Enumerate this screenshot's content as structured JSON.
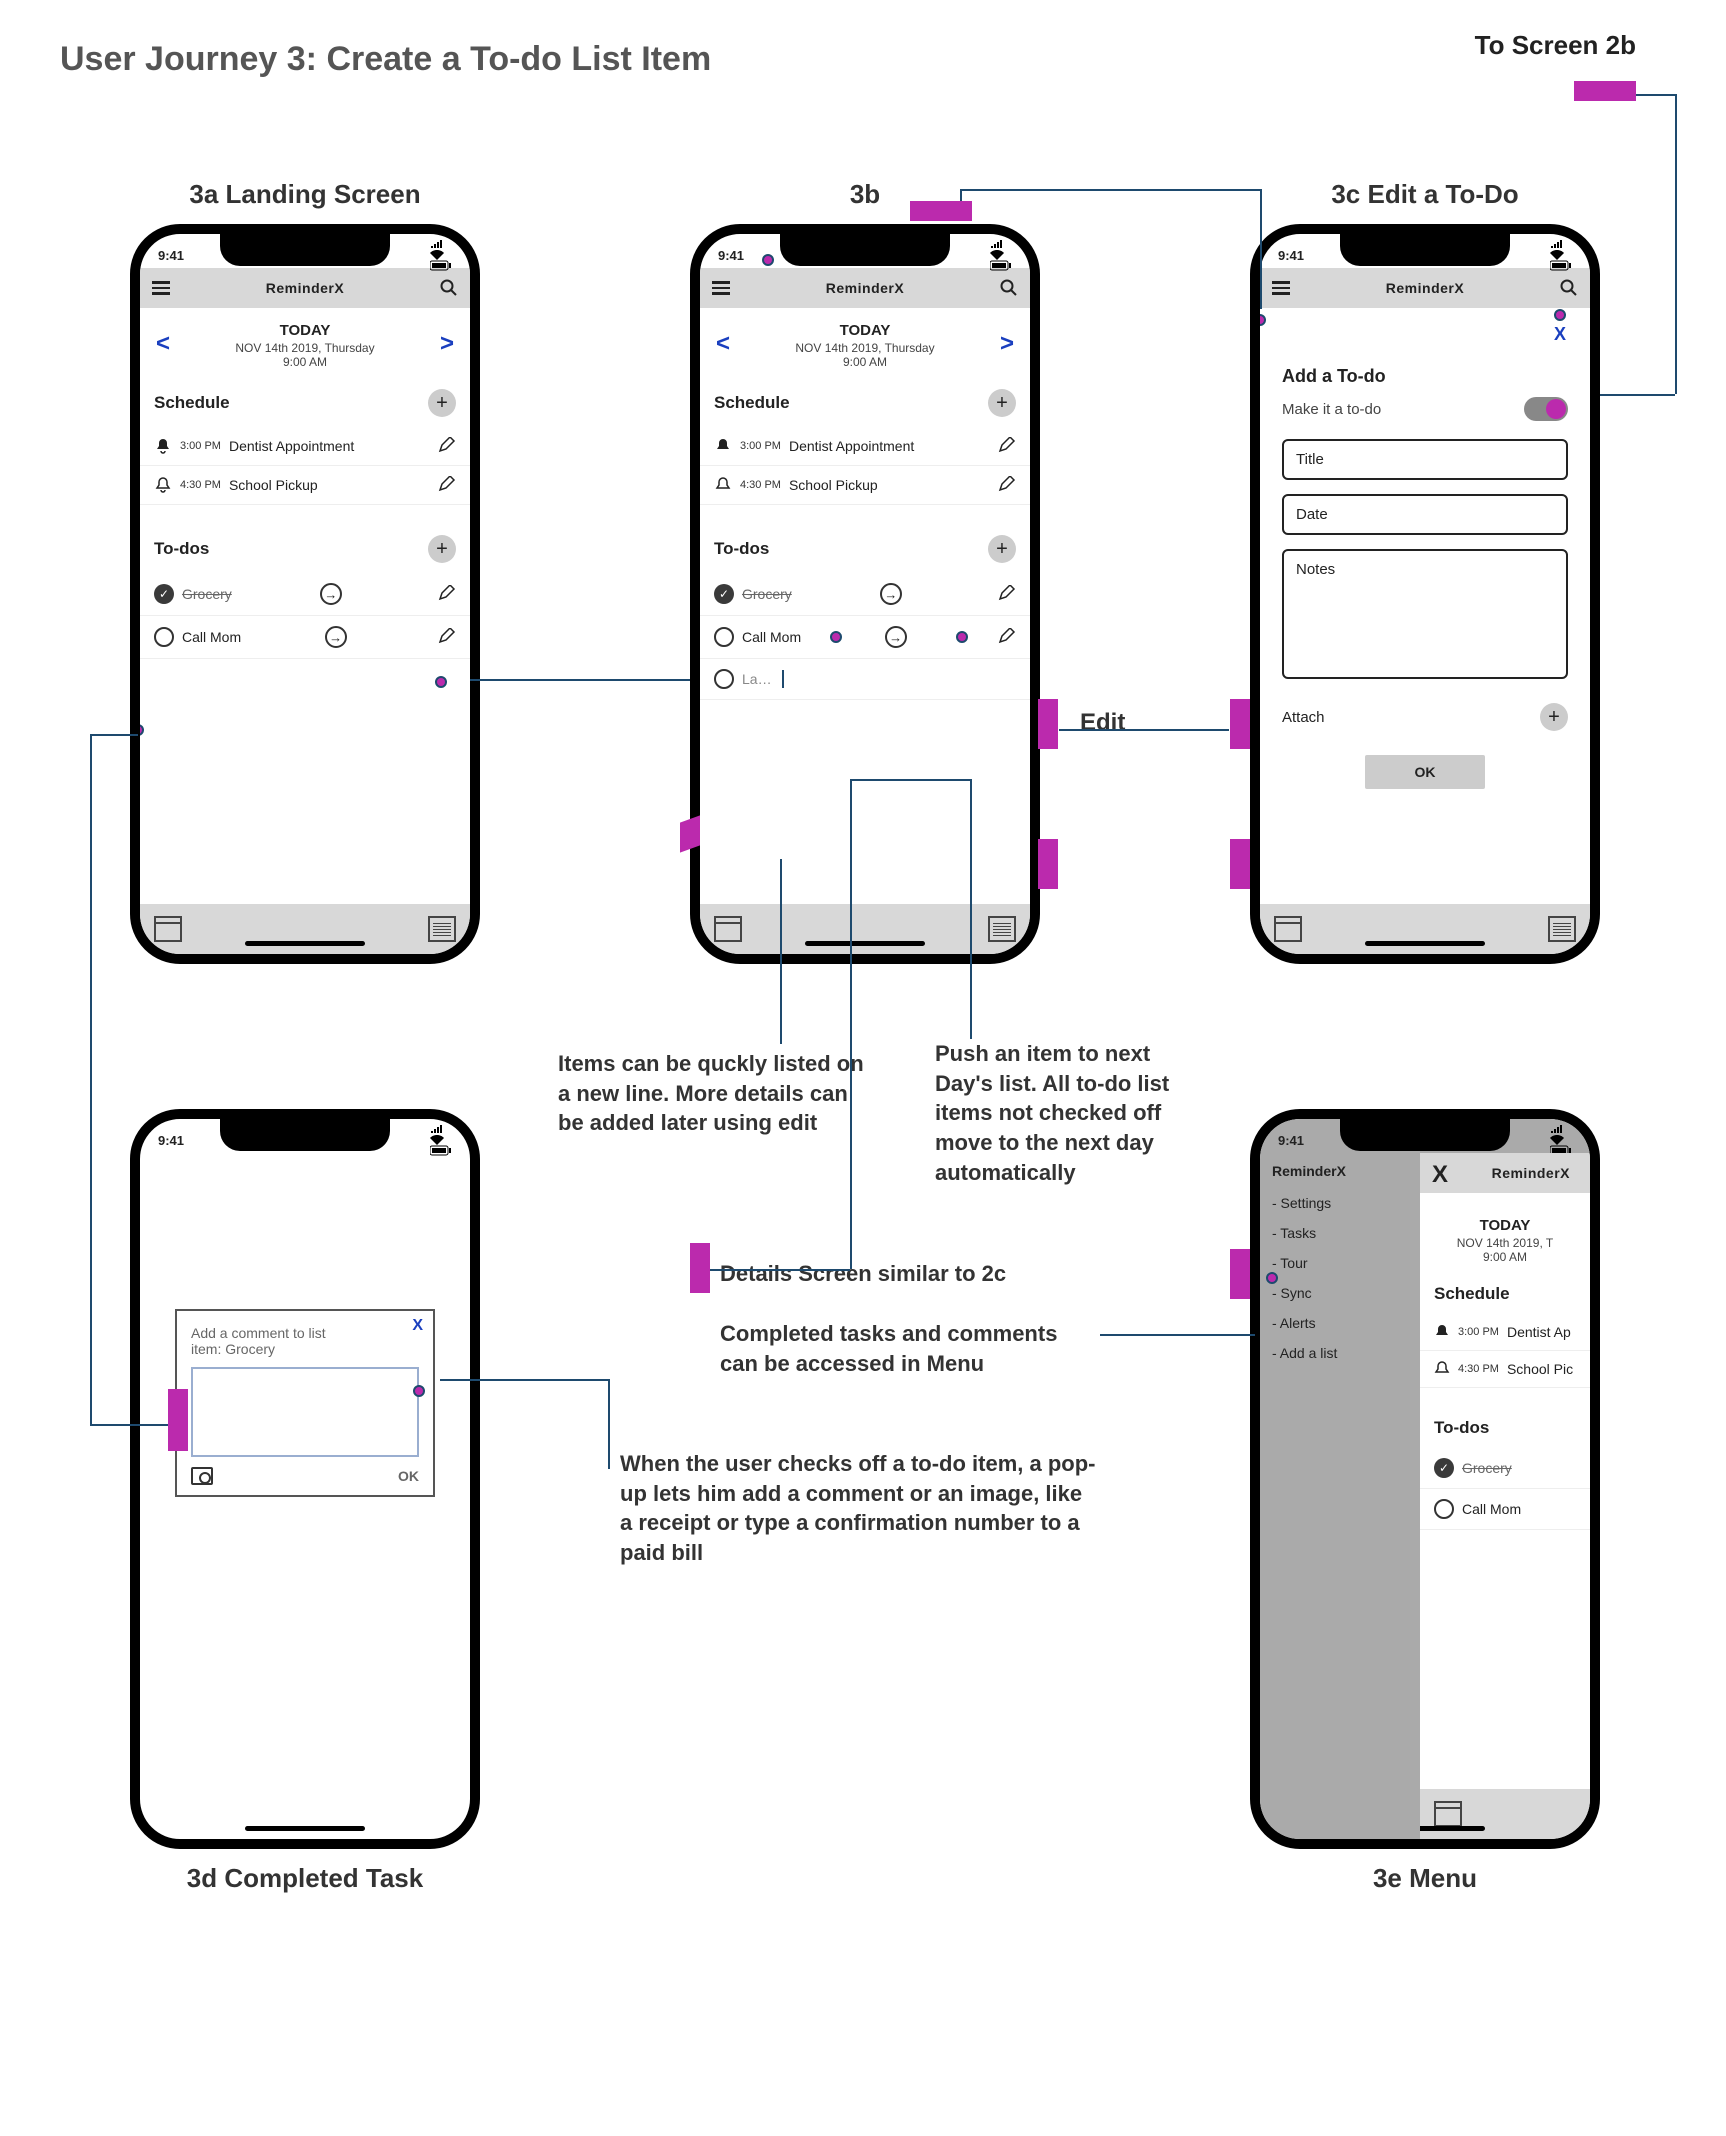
{
  "page_title": "User Journey 3: Create a To-do List Item",
  "to_2b_label": "To Screen 2b",
  "phones": {
    "a": {
      "label_num": "3a",
      "label_text": "Landing Screen",
      "time": "9:41",
      "app_title": "ReminderX",
      "today_label": "TODAY",
      "date": "NOV 14th 2019, Thursday",
      "clock": "9:00 AM",
      "section_schedule": "Schedule",
      "section_todos": "To-dos",
      "schedule": [
        {
          "time": "3:00 PM",
          "text": "Dentist Appointment",
          "alert": true
        },
        {
          "time": "4:30 PM",
          "text": "School Pickup",
          "alert": false
        }
      ],
      "todos": [
        {
          "text": "Grocery",
          "done": true
        },
        {
          "text": "Call Mom",
          "done": false
        }
      ]
    },
    "b": {
      "label_num": "3b",
      "label_text": "",
      "time": "9:41",
      "app_title": "ReminderX",
      "today_label": "TODAY",
      "date": "NOV 14th 2019, Thursday",
      "clock": "9:00 AM",
      "section_schedule": "Schedule",
      "section_todos": "To-dos",
      "schedule": [
        {
          "time": "3:00 PM",
          "text": "Dentist Appointment",
          "alert": true
        },
        {
          "time": "4:30 PM",
          "text": "School Pickup",
          "alert": false
        }
      ],
      "todos": [
        {
          "text": "Grocery",
          "done": true
        },
        {
          "text": "Call Mom",
          "done": false
        }
      ],
      "new_line_placeholder": "La…"
    },
    "c": {
      "label_num": "3c",
      "label_text": "Edit a To-Do",
      "time": "9:41",
      "app_title": "ReminderX",
      "heading": "Add a To-do",
      "toggle_label": "Make it a to-do",
      "field_title": "Title",
      "field_date": "Date",
      "field_notes": "Notes",
      "attach_label": "Attach",
      "ok_label": "OK",
      "close_x": "X"
    },
    "d": {
      "label_num": "3d",
      "label_text": "Completed Task",
      "time": "9:41",
      "popup_line1": "Add a comment to list",
      "popup_line2": "item: Grocery",
      "ok_label": "OK"
    },
    "e": {
      "label_num": "3e",
      "label_text": "Menu",
      "time": "9:41",
      "brand": "ReminderX",
      "app_title": "ReminderX",
      "today_label": "TODAY",
      "date": "NOV 14th 2019, T",
      "clock": "9:00 AM",
      "section_schedule": "Schedule",
      "section_todos": "To-dos",
      "close_x": "X",
      "menu_items": [
        "- Settings",
        "- Tasks",
        "- Tour",
        "- Sync",
        "- Alerts",
        "- Add a list"
      ],
      "schedule": [
        {
          "time": "3:00 PM",
          "text": "Dentist Ap"
        },
        {
          "time": "4:30 PM",
          "text": "School Pic"
        }
      ],
      "todos": [
        {
          "text": "Grocery",
          "done": true
        },
        {
          "text": "Call Mom",
          "done": false
        }
      ]
    }
  },
  "annotations": {
    "note_new_line": "Items can be quckly listed on a new line. More details can be added later using edit",
    "note_push": "Push an item to next Day's list. All to-do list items not checked off move to the next day automatically",
    "note_details": "Details Screen similar to 2c",
    "note_completed_menu": "Completed tasks and comments can be accessed in Menu",
    "note_popup": "When the user checks off a to-do item, a pop-up lets him add a comment or an image, like a receipt or type a confirmation number to a paid bill",
    "edit_label": "Edit"
  }
}
